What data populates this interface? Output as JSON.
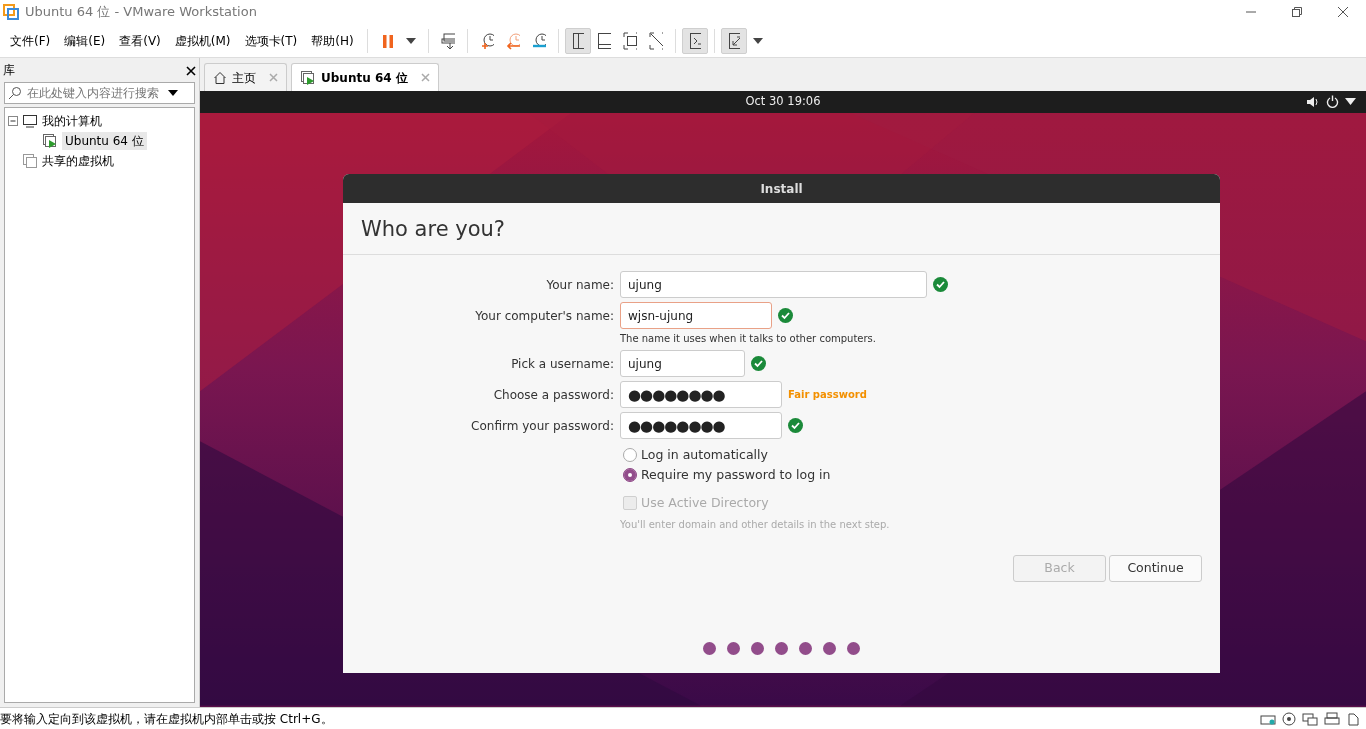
{
  "window": {
    "title": "Ubuntu 64 位 - VMware Workstation"
  },
  "menu": [
    "文件(F)",
    "编辑(E)",
    "查看(V)",
    "虚拟机(M)",
    "选项卡(T)",
    "帮助(H)"
  ],
  "toolbar": [
    {
      "kind": "pause",
      "pressed": false
    },
    {
      "kind": "send-keys",
      "pressed": false
    },
    {
      "kind": "snapshot",
      "pressed": false
    },
    {
      "kind": "revert",
      "pressed": false
    },
    {
      "kind": "manage",
      "pressed": false
    },
    {
      "kind": "library",
      "pressed": true
    },
    {
      "kind": "thumbnail",
      "pressed": false
    },
    {
      "kind": "fullscreen",
      "pressed": false
    },
    {
      "kind": "unity",
      "pressed": false
    },
    {
      "kind": "console",
      "pressed": true
    },
    {
      "kind": "stretch",
      "pressed": true
    }
  ],
  "library": {
    "title": "库",
    "search": {
      "placeholder": "在此处键入内容进行搜索"
    },
    "tree": [
      {
        "label": "我的计算机",
        "kind": "computer",
        "expanded": true,
        "selected": false,
        "children": [
          {
            "label": "Ubuntu 64 位",
            "kind": "vm",
            "selected": true
          }
        ]
      },
      {
        "label": "共享的虚拟机",
        "kind": "shared",
        "selected": false
      }
    ]
  },
  "tabs": [
    {
      "label": "主页",
      "kind": "home",
      "selected": false
    },
    {
      "label": "Ubuntu 64 位",
      "kind": "vm",
      "selected": true
    }
  ],
  "guest": {
    "clock": "Oct 30  19:06",
    "dialog": {
      "title": "Install",
      "heading": "Who are you?",
      "fields": [
        {
          "label": "Your name:",
          "value": "ujung",
          "focused": false,
          "valid": true
        },
        {
          "label": "Your computer's name:",
          "value": "wjsn-ujung",
          "focused": true,
          "valid": true,
          "hint": "The name it uses when it talks to other computers."
        },
        {
          "label": "Pick a username:",
          "value": "ujung",
          "focused": false,
          "valid": true
        },
        {
          "label": "Choose a password:",
          "value": "●●●●●●●●",
          "focused": false,
          "valid": false,
          "strength": "Fair password"
        },
        {
          "label": "Confirm your password:",
          "value": "●●●●●●●●",
          "focused": false,
          "valid": true
        }
      ],
      "login_options": [
        {
          "label": "Log in automatically",
          "selected": false
        },
        {
          "label": "Require my password to log in",
          "selected": true
        }
      ],
      "active_directory": {
        "label": "Use Active Directory",
        "checked": false,
        "disabled": true,
        "note": "You'll enter domain and other details in the next step."
      },
      "buttons": [
        {
          "label": "Back",
          "disabled": true
        },
        {
          "label": "Continue",
          "disabled": false
        }
      ],
      "progress_dots": [
        {
          "filled": true
        },
        {
          "filled": true
        },
        {
          "filled": true
        },
        {
          "filled": true
        },
        {
          "filled": true
        },
        {
          "filled": true
        },
        {
          "filled": true
        }
      ]
    }
  },
  "status_bar": "要将输入定向到该虚拟机，请在虚拟机内部单击或按 Ctrl+G。"
}
